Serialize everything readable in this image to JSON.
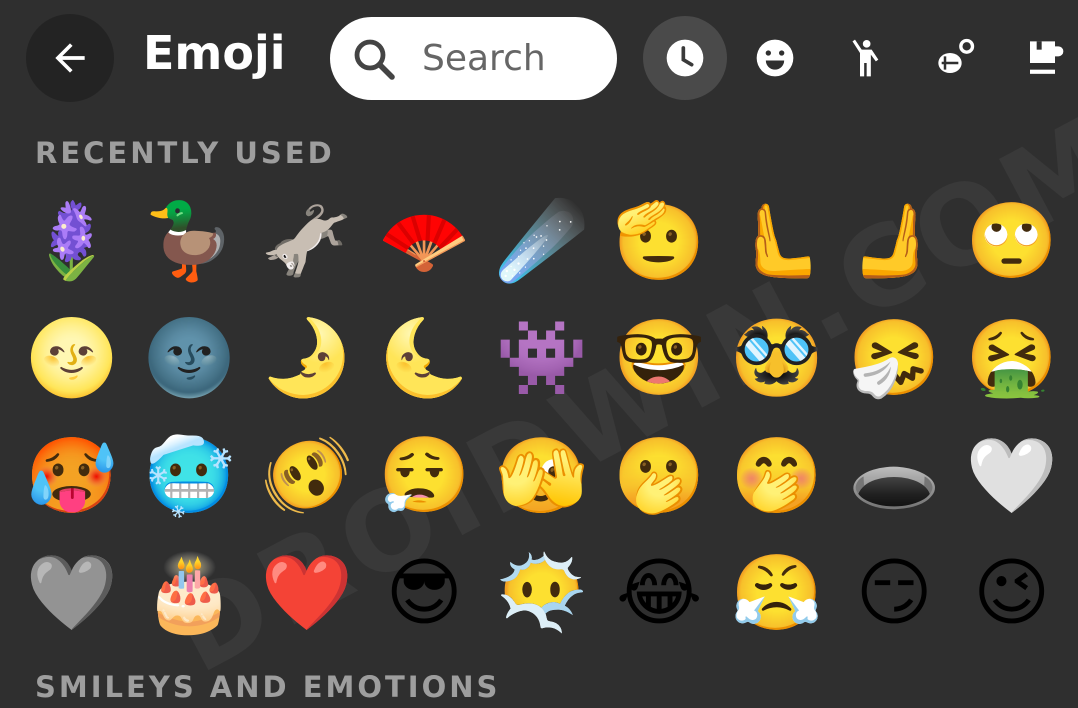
{
  "header": {
    "title": "Emoji",
    "back_icon": "arrow-left-icon",
    "search_placeholder": "Search"
  },
  "tabs": [
    {
      "name": "recent",
      "icon": "clock-icon",
      "active": true
    },
    {
      "name": "smileys",
      "icon": "smiley-icon",
      "active": false
    },
    {
      "name": "people",
      "icon": "person-icon",
      "active": false
    },
    {
      "name": "nature",
      "icon": "bee-flower-icon",
      "active": false
    },
    {
      "name": "food",
      "icon": "cup-icon",
      "active": false
    }
  ],
  "sections": {
    "recent": "RECENTLY USED",
    "smileys": "SMILEYS AND EMOTIONS"
  },
  "recent_emojis": [
    "🪻",
    "🦆",
    "🫏",
    "🪭",
    "☄️",
    "🫡",
    "🫷",
    "🫸",
    "🙄",
    "🌝",
    "🌚",
    "🌛",
    "🌜",
    "👾",
    "🤓",
    "🥸",
    "🤧",
    "🤮",
    "🥵",
    "🥶",
    "🫨",
    "😮‍💨",
    "🫣",
    "🫢",
    "🤭",
    "🕳️",
    "🤍",
    "🩶",
    "🎂",
    "❤️",
    "😎",
    "😶‍🌫️",
    "😂",
    "😤",
    "😏",
    "😉"
  ],
  "watermark": "DROIDWIN.COM",
  "colors": {
    "background": "#2f2f2f",
    "active_tab": "#4a4a4a",
    "section_label": "#9e9e9e"
  }
}
